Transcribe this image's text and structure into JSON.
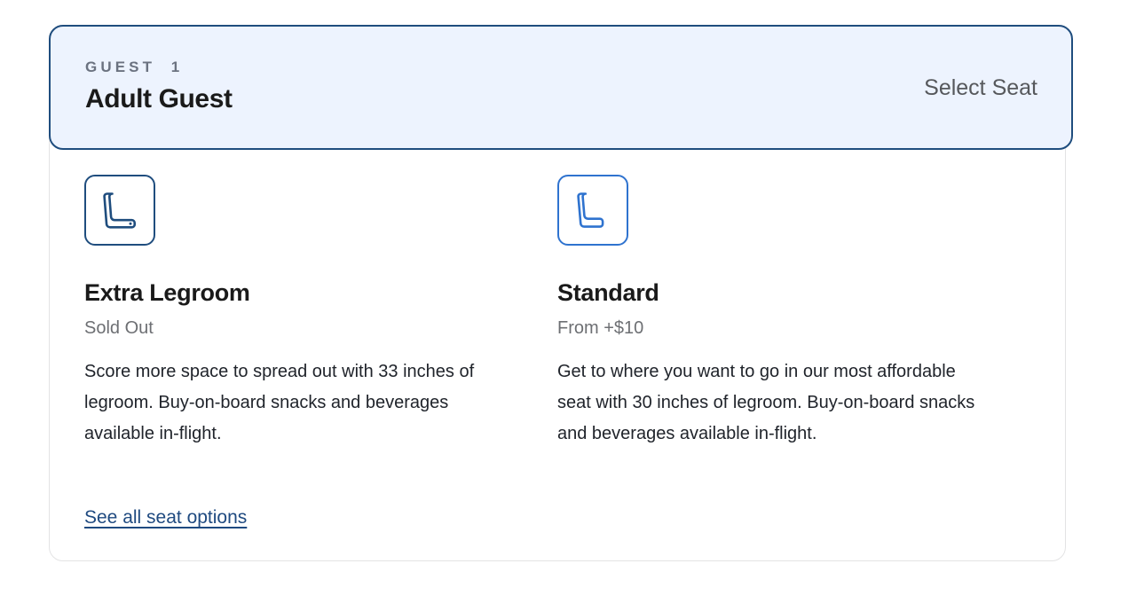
{
  "guest_header": {
    "eyebrow": "GUEST  1",
    "name": "Adult Guest",
    "action_label": "Select Seat"
  },
  "seat_options": [
    {
      "icon_name": "extra-legroom-seat-icon",
      "title": "Extra Legroom",
      "price": "Sold Out",
      "description": "Score more space to spread out with 33 inches of legroom. Buy-on-board snacks and beverages available in-flight."
    },
    {
      "icon_name": "standard-seat-icon",
      "title": "Standard",
      "price": "From +$10",
      "description": "Get to where you want to go in our most affordable seat with 30 inches of legroom. Buy-on-board snacks and beverages available in-flight."
    }
  ],
  "footer": {
    "see_all_label": "See all seat options"
  },
  "colors": {
    "header_background": "#edf3fe",
    "header_border": "#1f4d7e",
    "card_border": "#e3e3e4",
    "extra_legroom_accent": "#1f4d7e",
    "standard_accent": "#2f73cf",
    "link": "#1f4a80",
    "muted_text": "#6d6f73",
    "primary_text": "#1a1a1a"
  }
}
